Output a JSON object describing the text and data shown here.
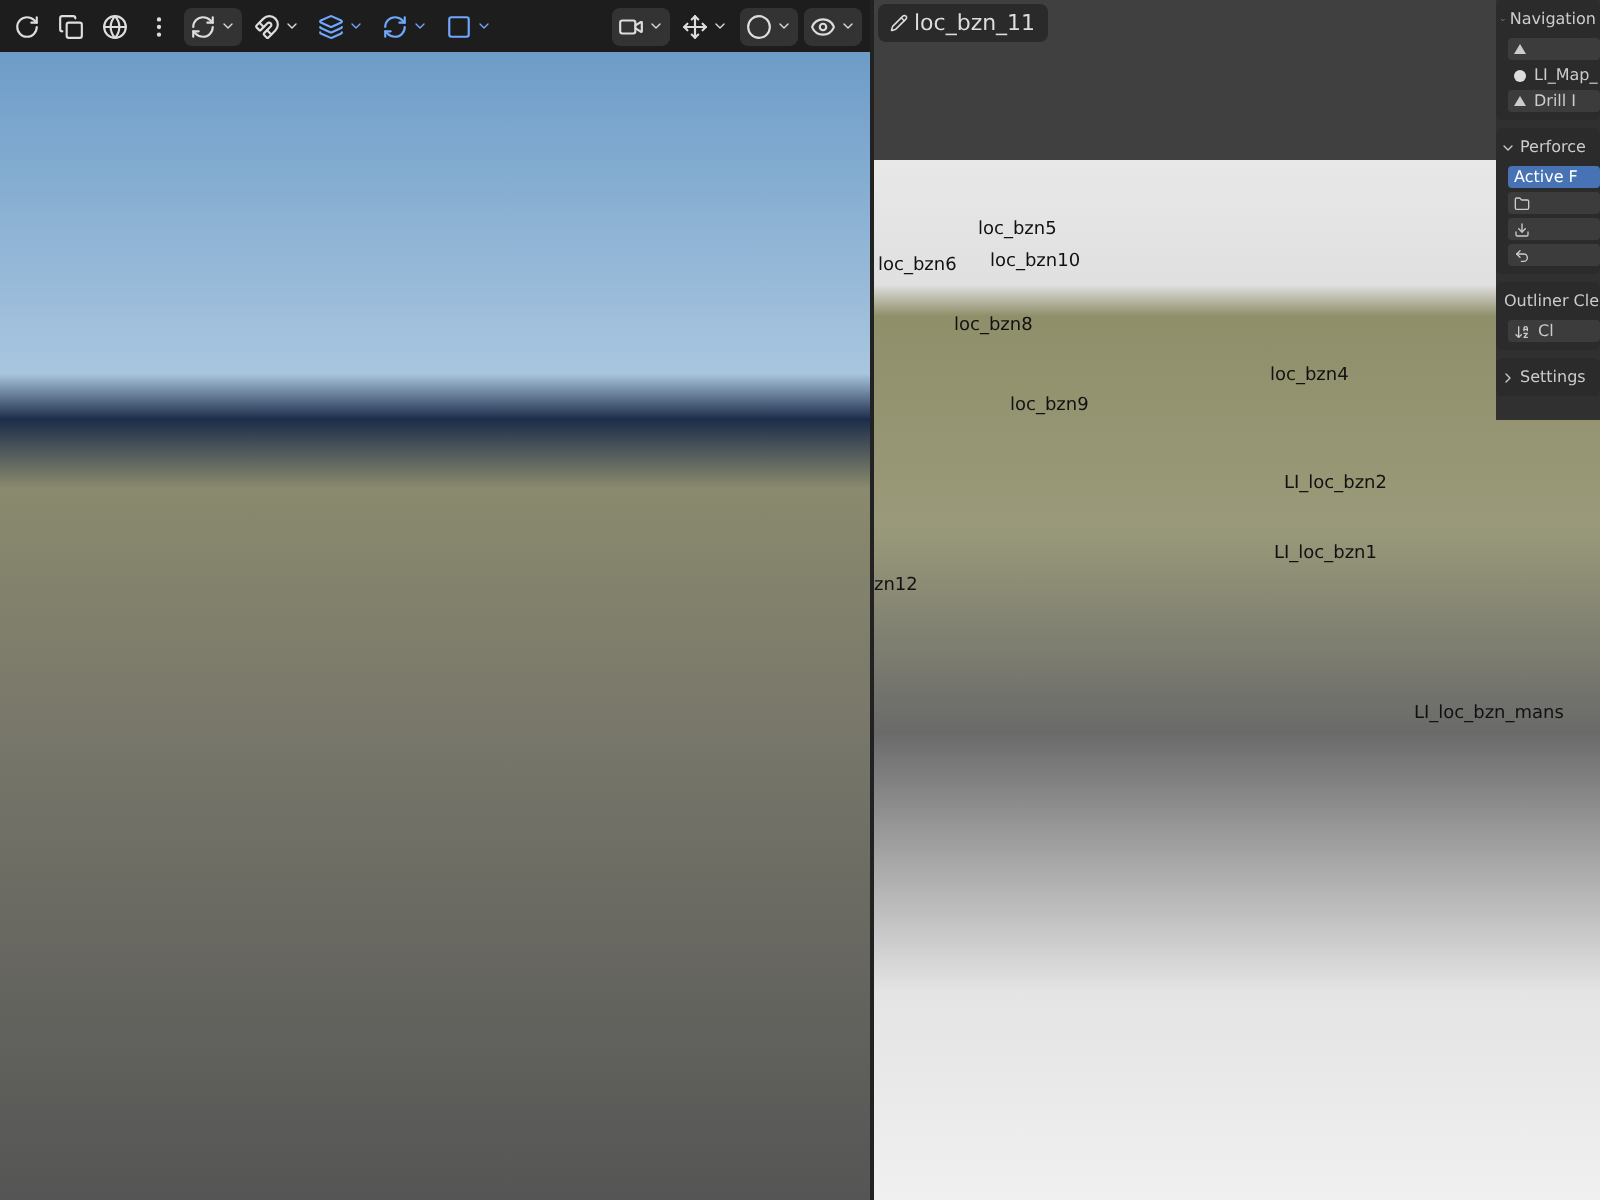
{
  "object_name": "loc_bzn_11",
  "viewport_labels": [
    {
      "text": "loc_bzn5"
    },
    {
      "text": "loc_bzn6"
    },
    {
      "text": "loc_bzn10"
    },
    {
      "text": "loc_bzn8"
    },
    {
      "text": "loc_bzn9"
    },
    {
      "text": "loc_bzn4"
    },
    {
      "text": "LI_loc_bzn2"
    },
    {
      "text": "LI_loc_bzn1"
    },
    {
      "text": "zn12"
    },
    {
      "text": "LI_loc_bzn_mans"
    }
  ],
  "side_panels": [
    {
      "title": "Navigation",
      "expanded": true,
      "rows": [
        {
          "kind": "icon"
        },
        {
          "kind": "radio",
          "text": "LI_Map_"
        },
        {
          "kind": "button",
          "text": "Drill I"
        }
      ]
    },
    {
      "title": "Perforce",
      "expanded": true,
      "rows": [
        {
          "kind": "primary",
          "text": "Active F"
        },
        {
          "kind": "icon"
        },
        {
          "kind": "icon"
        },
        {
          "kind": "icon"
        }
      ]
    },
    {
      "title": "Outliner Cle",
      "expanded": true,
      "rows": [
        {
          "kind": "sort",
          "text": "Cl"
        }
      ]
    },
    {
      "title": "Settings",
      "expanded": false
    }
  ]
}
